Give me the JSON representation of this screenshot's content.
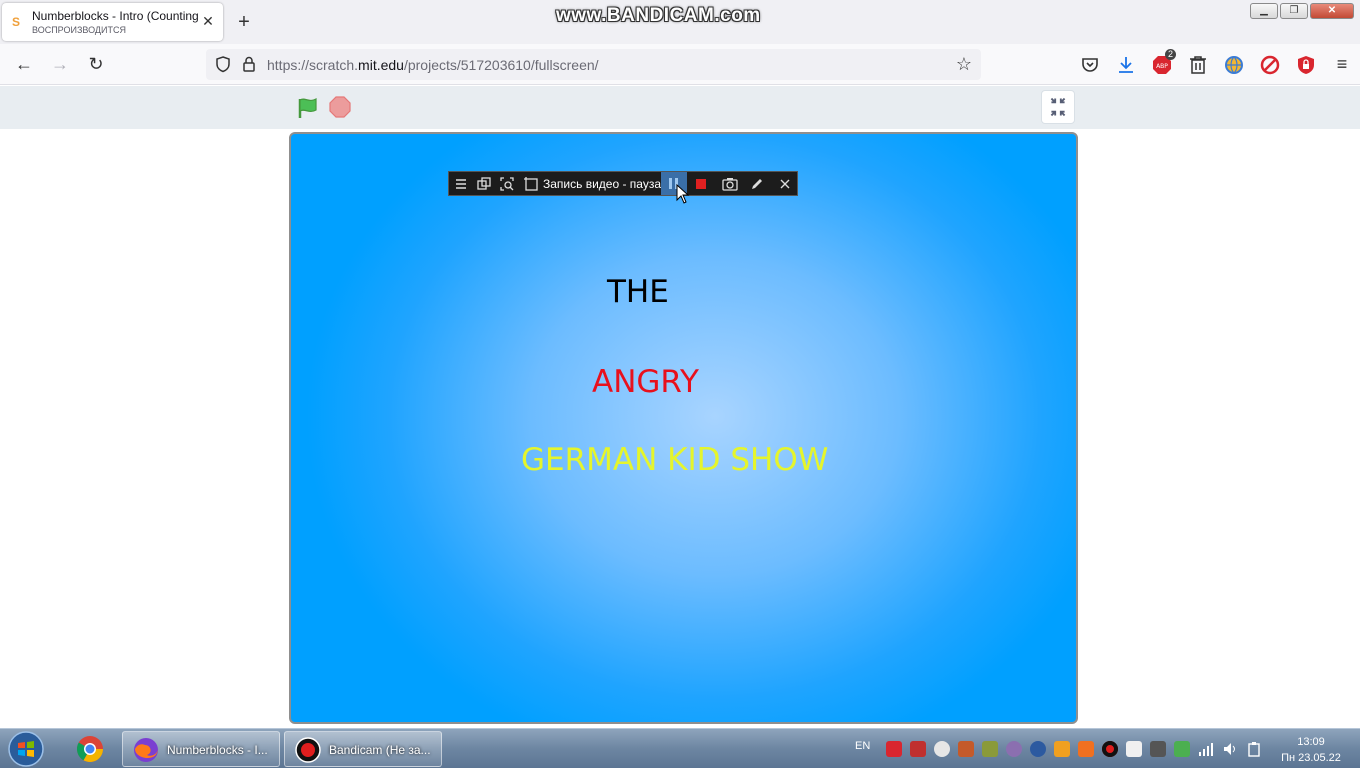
{
  "browser": {
    "tab": {
      "title": "Numberblocks - Intro (Counting",
      "subtitle": "ВОСПРОИЗВОДИТСЯ"
    },
    "new_tab_label": "+",
    "url_prefix": "https://scratch.",
    "url_domain": "mit.edu",
    "url_path": "/projects/517203610/fullscreen/",
    "badge_count": "2"
  },
  "watermark": "www.BANDICAM.com",
  "stage": {
    "line1": "THE",
    "line2": "ANGRY",
    "line3": "GERMAN KID SHOW",
    "colors": {
      "line1": "#000000",
      "line2": "#e8101c",
      "line3": "#e5f52c",
      "background": "#00a0ff"
    }
  },
  "bandicam_toolbar": {
    "status": "Запись видео - пауза"
  },
  "taskbar": {
    "firefox_label": "Numberblocks - I...",
    "bandicam_label": "Bandicam (Не за...",
    "language": "EN",
    "time": "13:09",
    "date": "Пн 23.05.22"
  }
}
